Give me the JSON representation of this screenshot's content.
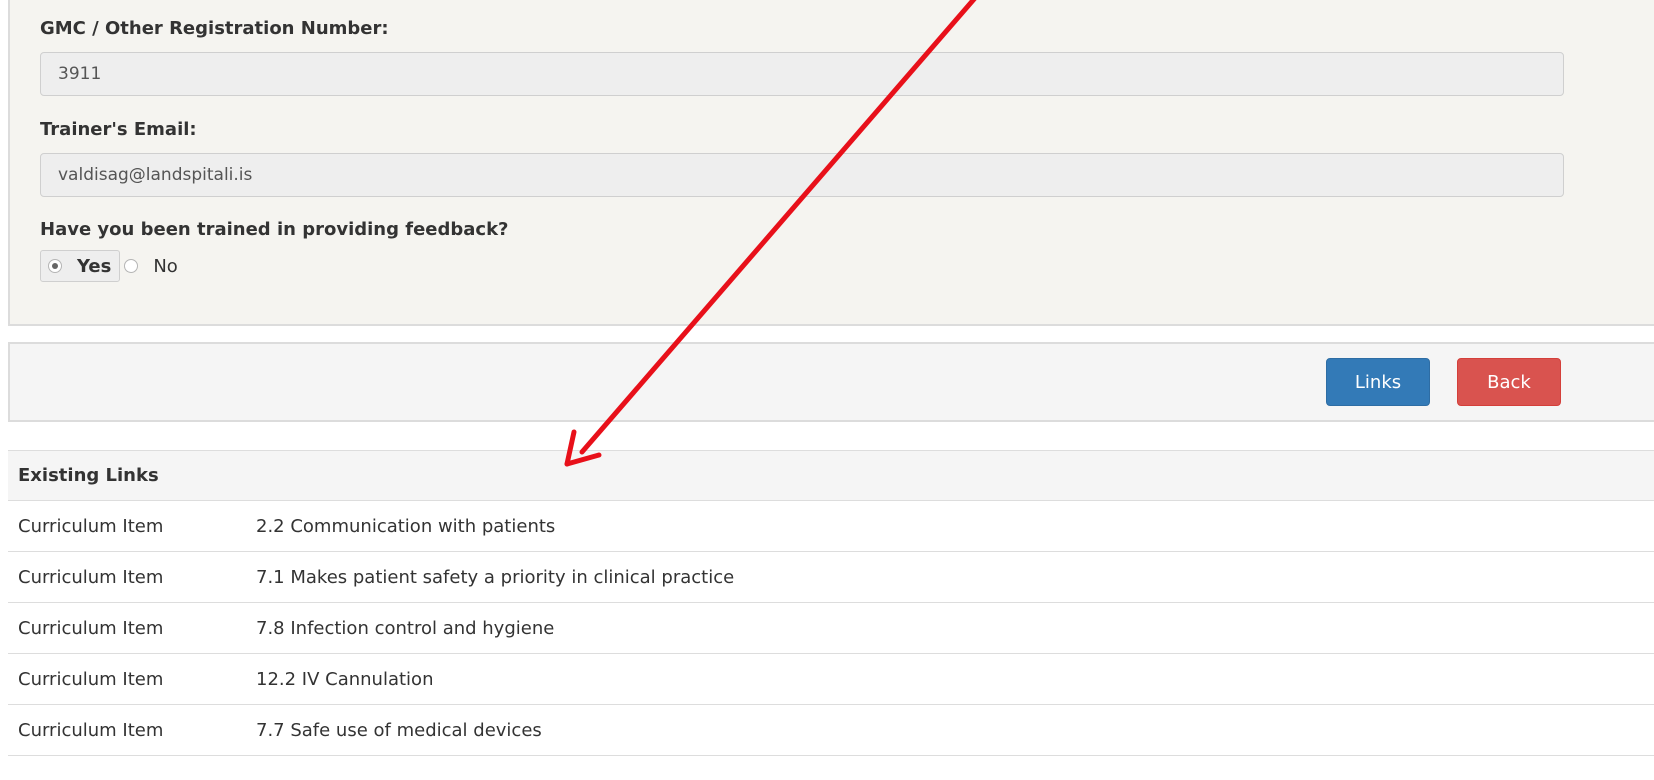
{
  "form": {
    "registration_label": "GMC / Other Registration Number:",
    "registration_value": "3911",
    "email_label": "Trainer's Email:",
    "email_value": "valdisag@landspitali.is",
    "feedback_question": "Have you been trained in providing feedback?",
    "feedback_options": [
      {
        "label": "Yes",
        "selected": true
      },
      {
        "label": "No",
        "selected": false
      }
    ]
  },
  "actions": {
    "links_label": "Links",
    "back_label": "Back"
  },
  "existing_links": {
    "heading": "Existing Links",
    "rows": [
      {
        "type": "Curriculum Item",
        "name": "2.2 Communication with patients"
      },
      {
        "type": "Curriculum Item",
        "name": "7.1 Makes patient safety a priority in clinical practice"
      },
      {
        "type": "Curriculum Item",
        "name": "7.8 Infection control and hygiene"
      },
      {
        "type": "Curriculum Item",
        "name": "12.2 IV Cannulation"
      },
      {
        "type": "Curriculum Item",
        "name": "7.7 Safe use of medical devices"
      }
    ]
  },
  "colors": {
    "primary_button": "#337ab7",
    "danger_button": "#d9534f",
    "annotation_arrow": "#e8101a"
  },
  "annotation": {
    "icon": "red-arrow-icon"
  }
}
